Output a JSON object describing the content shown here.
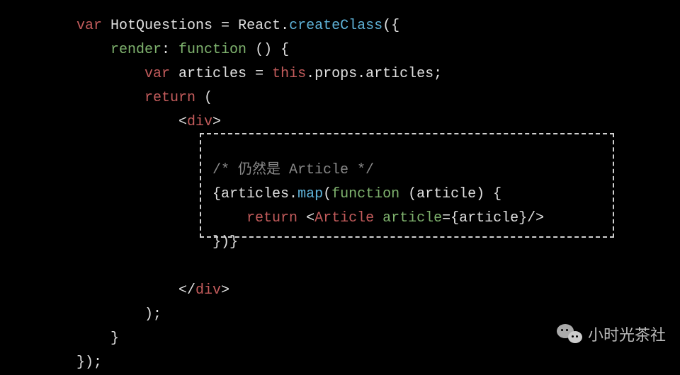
{
  "code": {
    "l1_var": "var",
    "l1_name": " HotQuestions ",
    "l1_eq": "= ",
    "l1_react": "React",
    "l1_dot": ".",
    "l1_create": "createClass",
    "l1_paren": "({",
    "l2_indent": "    ",
    "l2_render": "render",
    "l2_colon": ": ",
    "l2_func": "function",
    "l2_rest": " () {",
    "l3_indent": "        ",
    "l3_var": "var",
    "l3_articles": " articles ",
    "l3_eq": "= ",
    "l3_this": "this",
    "l3_rest": ".props.articles;",
    "l4_indent": "        ",
    "l4_return": "return",
    "l4_paren": " (",
    "l5_indent": "            <",
    "l5_div": "div",
    "l5_close": ">",
    "l6_blank": " ",
    "l7_indent": "                ",
    "l7_comment": "/* 仍然是 Article */",
    "l8_indent": "                {articles.",
    "l8_map": "map",
    "l8_open": "(",
    "l8_func": "function",
    "l8_rest": " (article) {",
    "l9_indent": "                    ",
    "l9_return": "return",
    "l9_sp": " <",
    "l9_tag": "Article",
    "l9_sp2": " ",
    "l9_attr": "article",
    "l9_eq": "=",
    "l9_val": "{article}",
    "l9_close": "/>",
    "l10_indent": "                })}",
    "l11_blank": " ",
    "l12_indent": "            </",
    "l12_div": "div",
    "l12_close": ">",
    "l13_indent": "        );",
    "l14_indent": "    }",
    "l15": "});"
  },
  "watermark": "小时光茶社"
}
